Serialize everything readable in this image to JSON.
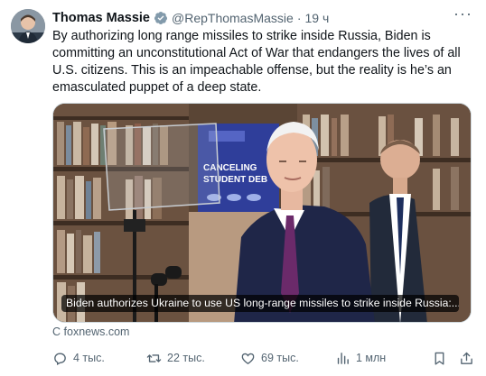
{
  "author": {
    "name": "Thomas Massie",
    "handle": "@RepThomasMassie",
    "separator": "·",
    "time": "19 ч",
    "avatar_icon": "avatar-photo"
  },
  "tweet": {
    "text": "By authorizing long range missiles to strike inside Russia, Biden is committing  an unconstitutional Act of War that endangers the lives of all U.S. citizens. This is an impeachable offense, but the reality is he’s an emasculated puppet of a deep state."
  },
  "media": {
    "caption": "Biden authorizes Ukraine to use US long-range missiles to strike inside Russia:...",
    "backdrop_sign": "CANCELING STUDENT DEBT"
  },
  "source": "foxnews.com",
  "source_prefix": "С",
  "actions": {
    "replies": "4 тыс.",
    "reposts": "22 тыс.",
    "likes": "69 тыс.",
    "views": "1 млн"
  },
  "colors": {
    "verified": "#1d9bf0",
    "muted": "#536471",
    "text": "#0f1419"
  }
}
